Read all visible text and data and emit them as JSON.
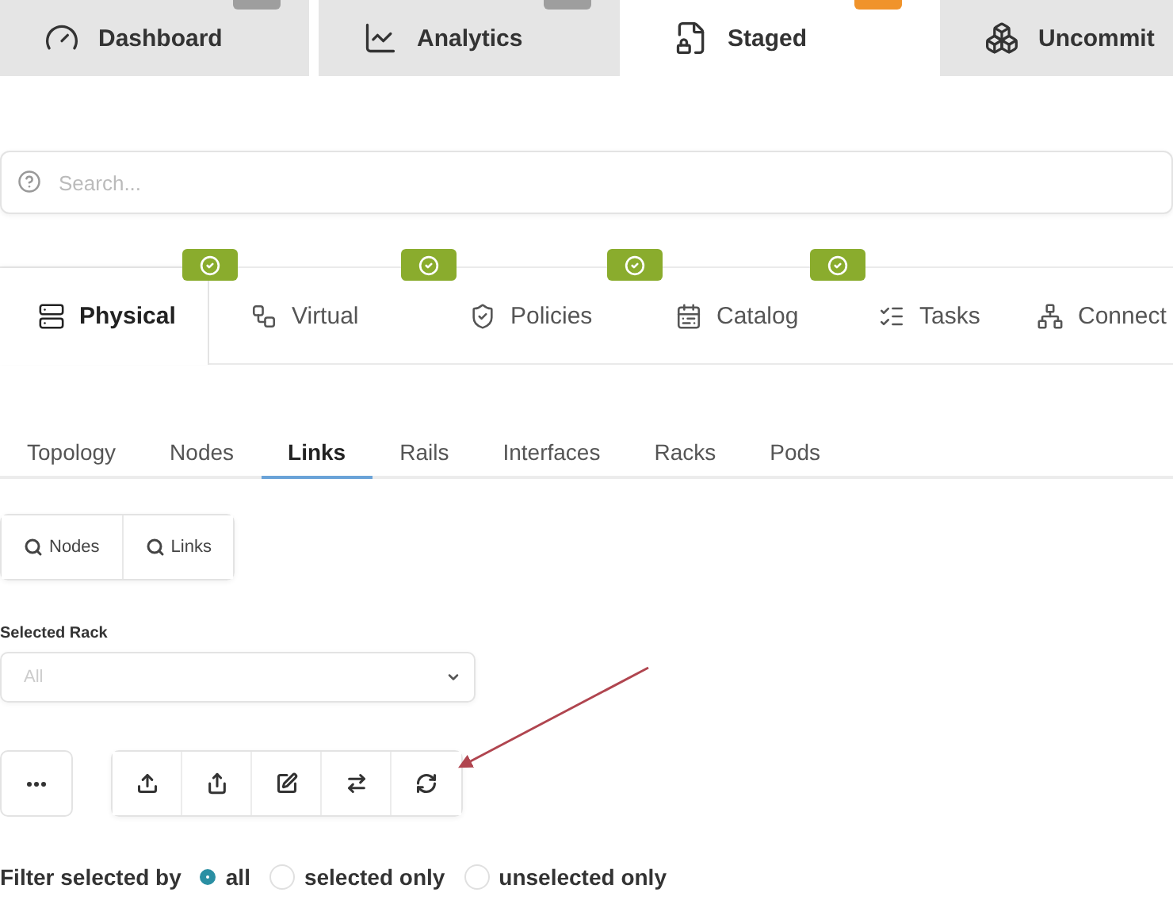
{
  "top_tabs": [
    {
      "label": "Dashboard",
      "selected": false,
      "color": "#9e9e9e"
    },
    {
      "label": "Analytics",
      "selected": false,
      "color": "#9e9e9e"
    },
    {
      "label": "Staged",
      "selected": true,
      "color": "#f0932b"
    },
    {
      "label": "Uncommit",
      "selected": false
    }
  ],
  "search": {
    "placeholder": "Search..."
  },
  "section_tabs": [
    {
      "label": "Physical",
      "selected": true,
      "checked": true
    },
    {
      "label": "Virtual",
      "selected": false,
      "checked": true
    },
    {
      "label": "Policies",
      "selected": false,
      "checked": true
    },
    {
      "label": "Catalog",
      "selected": false,
      "checked": true
    },
    {
      "label": "Tasks",
      "selected": false,
      "checked": false
    },
    {
      "label": "Connect",
      "selected": false,
      "checked": false
    }
  ],
  "sub_tabs": [
    {
      "label": "Topology",
      "selected": false
    },
    {
      "label": "Nodes",
      "selected": false
    },
    {
      "label": "Links",
      "selected": true
    },
    {
      "label": "Rails",
      "selected": false
    },
    {
      "label": "Interfaces",
      "selected": false
    },
    {
      "label": "Racks",
      "selected": false
    },
    {
      "label": "Pods",
      "selected": false
    }
  ],
  "search_buttons": [
    "Nodes",
    "Links"
  ],
  "selected_rack": {
    "label": "Selected Rack",
    "placeholder": "All"
  },
  "filter": {
    "label": "Filter selected by",
    "options": [
      {
        "label": "all",
        "selected": true
      },
      {
        "label": "selected only",
        "selected": false
      },
      {
        "label": "unselected only",
        "selected": false
      }
    ]
  }
}
